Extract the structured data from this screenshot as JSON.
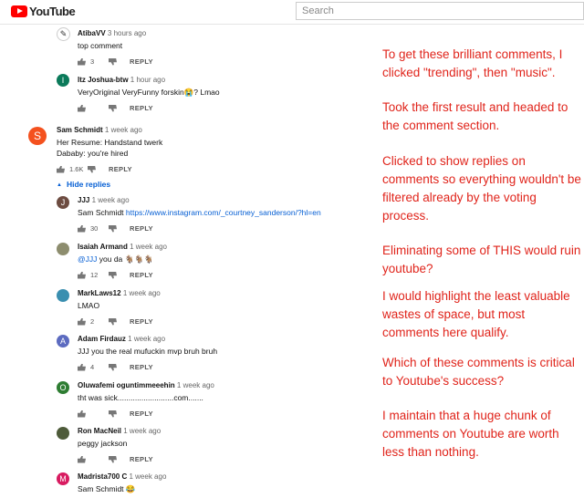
{
  "header": {
    "logo_text": "YouTube",
    "search_placeholder": "Search"
  },
  "colors": {
    "brand": "#ff0000",
    "link": "#065fd4",
    "annotation": "#e0241b"
  },
  "actions": {
    "reply_label": "REPLY"
  },
  "hide_replies_label": "Hide replies",
  "comments": [
    {
      "author": "AtibaVV",
      "time": "3 hours ago",
      "text": "top comment",
      "likes": "3",
      "avatar_letter": "",
      "avatar_color": "#ffffff"
    },
    {
      "author": "Itz Joshua-btw",
      "time": "1 hour ago",
      "text": "VeryOriginal VeryFunny forskin😭? Lmao",
      "likes": "",
      "avatar_letter": "I",
      "avatar_color": "#0b7a5a"
    },
    {
      "author": "Sam Schmidt",
      "time": "1 week ago",
      "text": "Her Resume: Handstand twerk",
      "text2": "Dababy: you're hired",
      "likes": "1.6K",
      "avatar_letter": "S",
      "avatar_color": "#f4511e"
    },
    {
      "author": "JJJ",
      "time": "1 week ago",
      "text_prefix": "Sam Schmidt ",
      "text_link": "https://www.instagram.com/_courtney_sanderson/?hl=en",
      "likes": "30",
      "avatar_letter": "J",
      "avatar_color": "#6d4c41"
    },
    {
      "author": "Isaiah Armand",
      "time": "1 week ago",
      "text_mention": "@JJJ",
      "text": " you da 🐐🐐🐐",
      "likes": "12",
      "avatar_letter": "",
      "avatar_color": "#8d8d6e"
    },
    {
      "author": "MarkLaws12",
      "time": "1 week ago",
      "text": "LMAO",
      "likes": "2",
      "avatar_letter": "",
      "avatar_color": "#3a8fb0"
    },
    {
      "author": "Adam Firdauz",
      "time": "1 week ago",
      "text": "JJJ you the real mufuckin mvp bruh bruh",
      "likes": "4",
      "avatar_letter": "A",
      "avatar_color": "#5c6bc0"
    },
    {
      "author": "Oluwafemi oguntimmeeehin",
      "time": "1 week ago",
      "text": "tht was sick..........................com.......",
      "likes": "",
      "avatar_letter": "O",
      "avatar_color": "#2e7d32"
    },
    {
      "author": "Ron MacNeil",
      "time": "1 week ago",
      "text": "peggy jackson",
      "likes": "",
      "avatar_letter": "",
      "avatar_color": "#4e5b3a"
    },
    {
      "author": "Madrista700 C",
      "time": "1 week ago",
      "text": "Sam Schmidt 😂",
      "likes": "",
      "avatar_letter": "M",
      "avatar_color": "#d81b60"
    }
  ],
  "annotation": [
    "To get these brilliant comments, I clicked \"trending\", then \"music\".",
    "Took the first result and headed to the comment section.",
    "Clicked to show replies on comments so everything wouldn't be filtered already by the voting process.",
    "Eliminating some of THIS would ruin youtube?",
    "I would highlight the least valuable wastes of space, but most comments here qualify.",
    "Which of these comments is critical to Youtube's success?",
    "I maintain that a huge chunk of comments on Youtube are worth less than nothing."
  ]
}
